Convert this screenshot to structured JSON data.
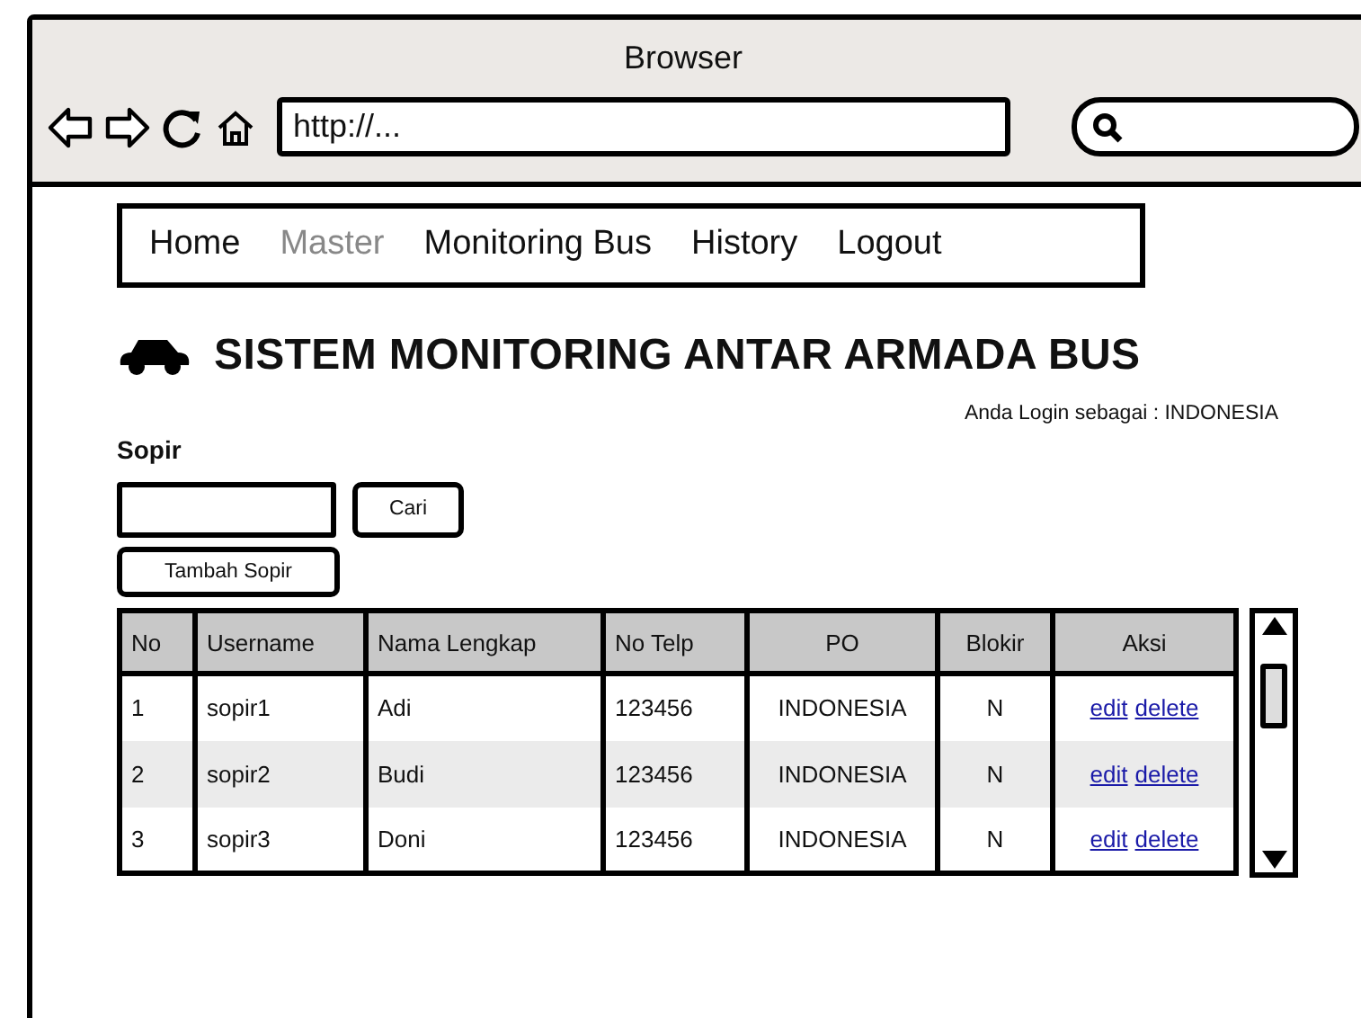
{
  "window": {
    "title": "Browser",
    "url": "http://..."
  },
  "menu": [
    {
      "label": "Home",
      "disabled": false
    },
    {
      "label": "Master",
      "disabled": true
    },
    {
      "label": "Monitoring Bus",
      "disabled": false
    },
    {
      "label": "History",
      "disabled": false
    },
    {
      "label": "Logout",
      "disabled": false
    }
  ],
  "page_title": "SISTEM MONITORING ANTAR ARMADA BUS",
  "login_info": "Anda Login sebagai : INDONESIA",
  "section_title": "Sopir",
  "search_button": "Cari",
  "add_button": "Tambah Sopir",
  "table": {
    "columns": [
      "No",
      "Username",
      "Nama Lengkap",
      "No Telp",
      "PO",
      "Blokir",
      "Aksi"
    ],
    "rows": [
      {
        "cells": [
          "1",
          "sopir1",
          "Adi",
          "123456",
          "INDONESIA",
          "N"
        ],
        "actions": [
          "edit",
          "delete"
        ]
      },
      {
        "cells": [
          "2",
          "sopir2",
          "Budi",
          "123456",
          "INDONESIA",
          "N"
        ],
        "actions": [
          "edit",
          "delete"
        ]
      },
      {
        "cells": [
          "3",
          "sopir3",
          "Doni",
          "123456",
          "INDONESIA",
          "N"
        ],
        "actions": [
          "edit",
          "delete"
        ]
      }
    ]
  }
}
